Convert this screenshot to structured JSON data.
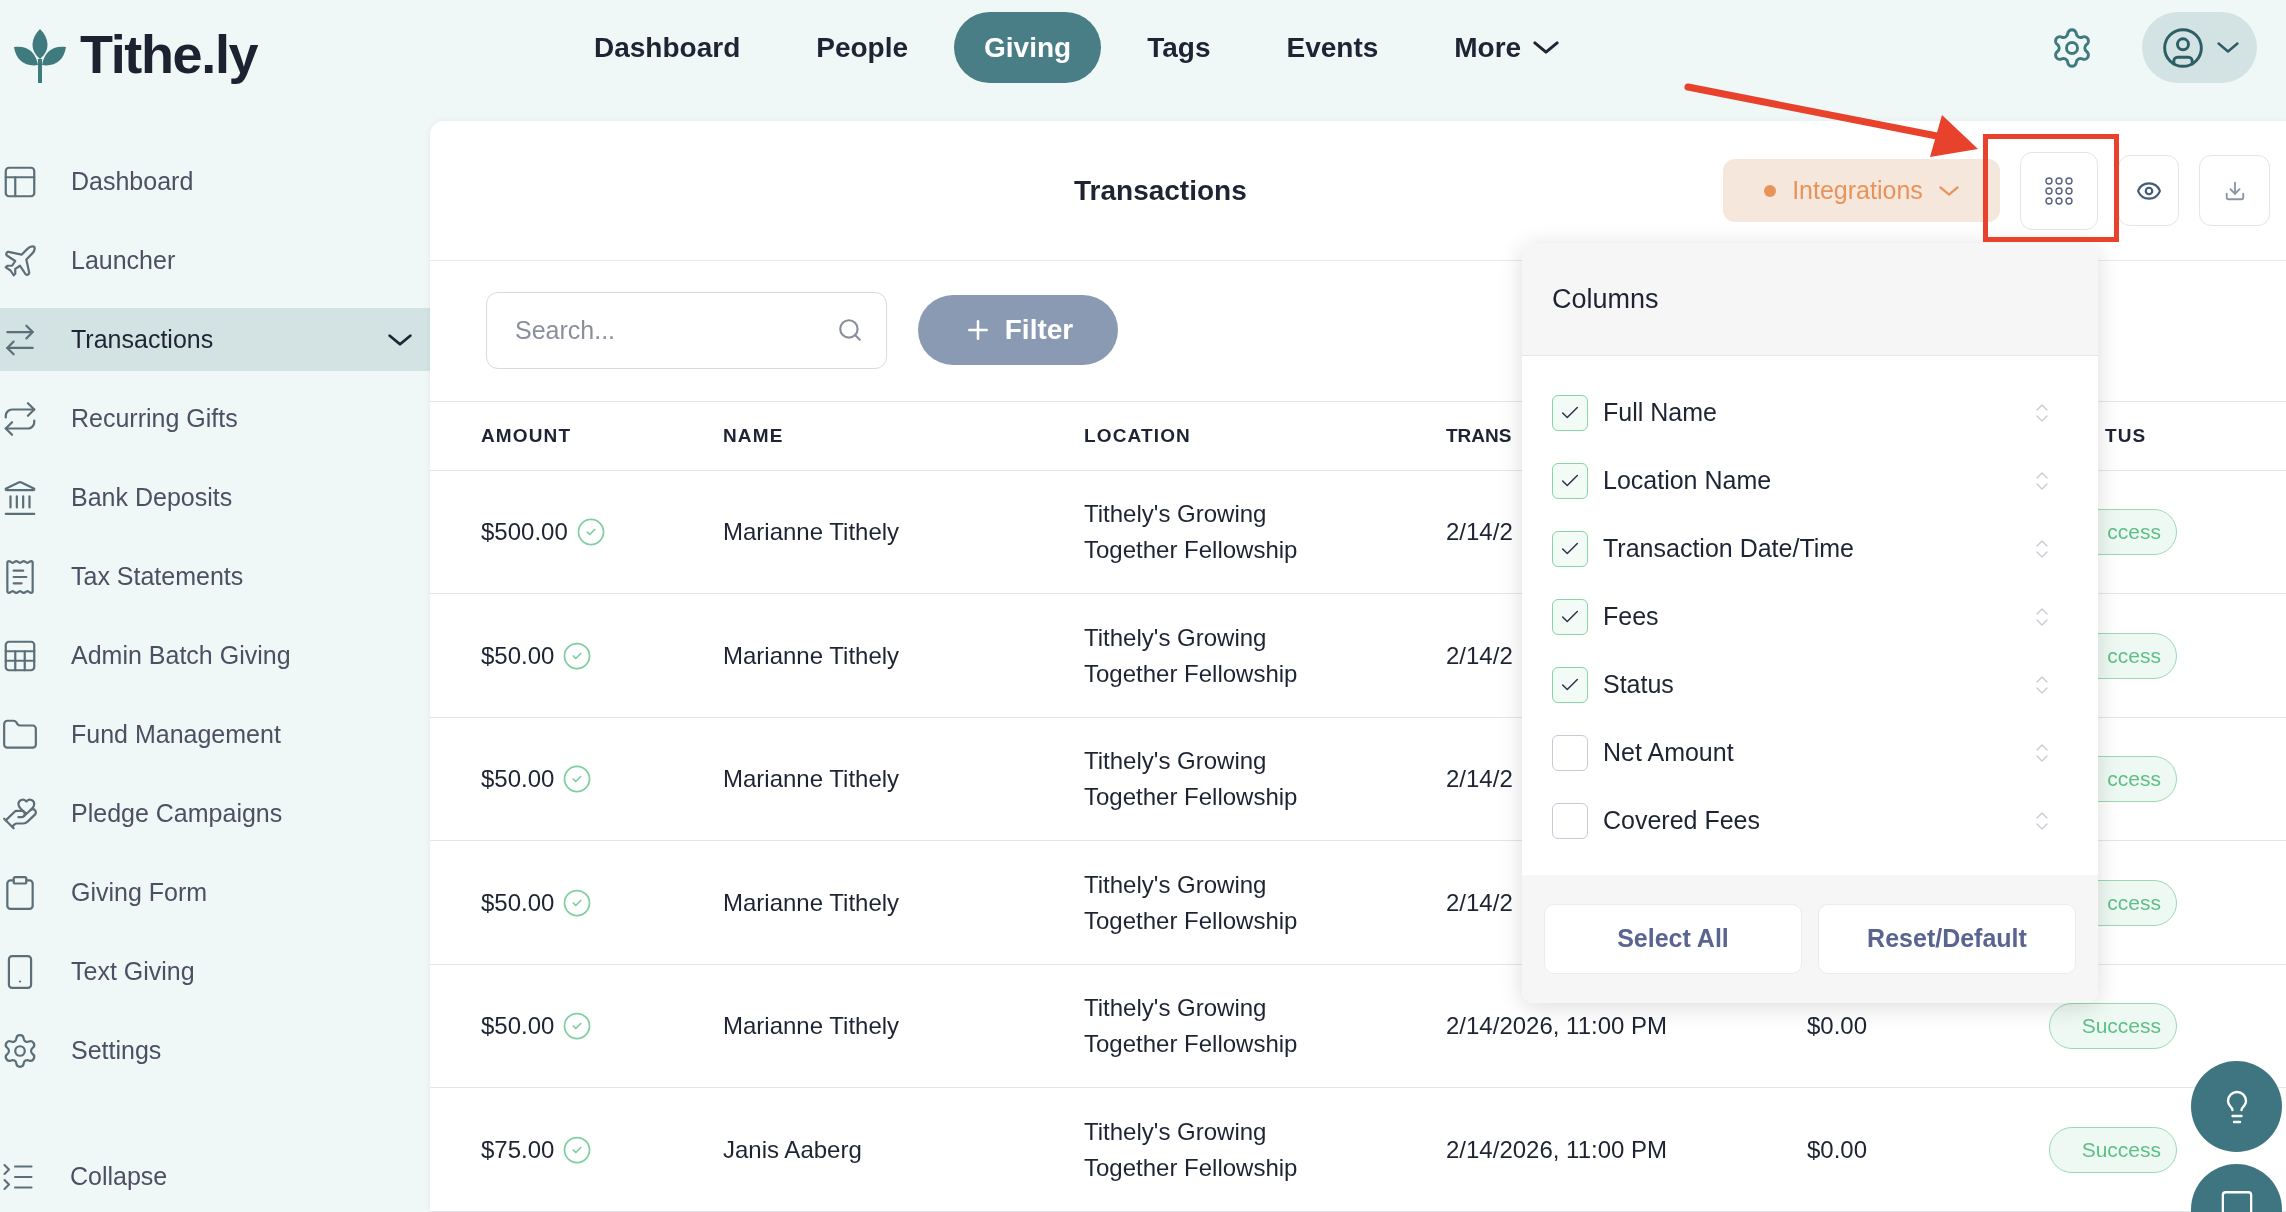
{
  "logo": {
    "text": "Tithe.ly"
  },
  "nav": [
    {
      "label": "Dashboard",
      "selected": false,
      "has_menu": false
    },
    {
      "label": "People",
      "selected": false,
      "has_menu": false
    },
    {
      "label": "Giving",
      "selected": true,
      "has_menu": false
    },
    {
      "label": "Tags",
      "selected": false,
      "has_menu": false
    },
    {
      "label": "Events",
      "selected": false,
      "has_menu": false
    },
    {
      "label": "More",
      "selected": false,
      "has_menu": true
    }
  ],
  "sidebar": {
    "items": [
      {
        "label": "Dashboard",
        "selected": false,
        "expandable": false
      },
      {
        "label": "Launcher",
        "selected": false,
        "expandable": false
      },
      {
        "label": "Transactions",
        "selected": true,
        "expandable": true
      },
      {
        "label": "Recurring Gifts",
        "selected": false,
        "expandable": false
      },
      {
        "label": "Bank Deposits",
        "selected": false,
        "expandable": false
      },
      {
        "label": "Tax Statements",
        "selected": false,
        "expandable": false
      },
      {
        "label": "Admin Batch Giving",
        "selected": false,
        "expandable": false
      },
      {
        "label": "Fund Management",
        "selected": false,
        "expandable": false
      },
      {
        "label": "Pledge Campaigns",
        "selected": false,
        "expandable": false
      },
      {
        "label": "Giving Form",
        "selected": false,
        "expandable": false
      },
      {
        "label": "Text Giving",
        "selected": false,
        "expandable": false
      },
      {
        "label": "Settings",
        "selected": false,
        "expandable": false
      }
    ],
    "collapse": "Collapse"
  },
  "page": {
    "title": "Transactions",
    "integrations_button": "Integrations"
  },
  "search": {
    "placeholder": "Search..."
  },
  "filter_button": "Filter",
  "table": {
    "columns": [
      "AMOUNT",
      "NAME",
      "LOCATION",
      "TRANS",
      "TUS"
    ],
    "rows": [
      {
        "amount": "$500.00",
        "verified": true,
        "name": "Marianne Tithely",
        "location": "Tithely's Growing Together Fellowship",
        "date": "2/14/2",
        "status": "ccess"
      },
      {
        "amount": "$50.00",
        "verified": true,
        "name": "Marianne Tithely",
        "location": "Tithely's Growing Together Fellowship",
        "date": "2/14/2",
        "status": "ccess"
      },
      {
        "amount": "$50.00",
        "verified": true,
        "name": "Marianne Tithely",
        "location": "Tithely's Growing Together Fellowship",
        "date": "2/14/2",
        "status": "ccess"
      },
      {
        "amount": "$50.00",
        "verified": true,
        "name": "Marianne Tithely",
        "location": "Tithely's Growing Together Fellowship",
        "date": "2/14/2",
        "status": "ccess"
      },
      {
        "amount": "$50.00",
        "verified": true,
        "name": "Marianne Tithely",
        "location": "Tithely's Growing Together Fellowship",
        "date": "2/14/2026, 11:00 PM",
        "fees": "$0.00",
        "status": "Success"
      },
      {
        "amount": "$75.00",
        "verified": true,
        "name": "Janis Aaberg",
        "location": "Tithely's Growing Together Fellowship",
        "date": "2/14/2026, 11:00 PM",
        "fees": "$0.00",
        "status": "Success"
      }
    ]
  },
  "columns_menu": {
    "title": "Columns",
    "items": [
      {
        "label": "Full Name",
        "checked": true
      },
      {
        "label": "Location Name",
        "checked": true
      },
      {
        "label": "Transaction Date/Time",
        "checked": true
      },
      {
        "label": "Fees",
        "checked": true
      },
      {
        "label": "Status",
        "checked": true
      },
      {
        "label": "Net Amount",
        "checked": false
      },
      {
        "label": "Covered Fees",
        "checked": false
      }
    ],
    "buttons": [
      "Select All",
      "Reset/Default"
    ]
  }
}
